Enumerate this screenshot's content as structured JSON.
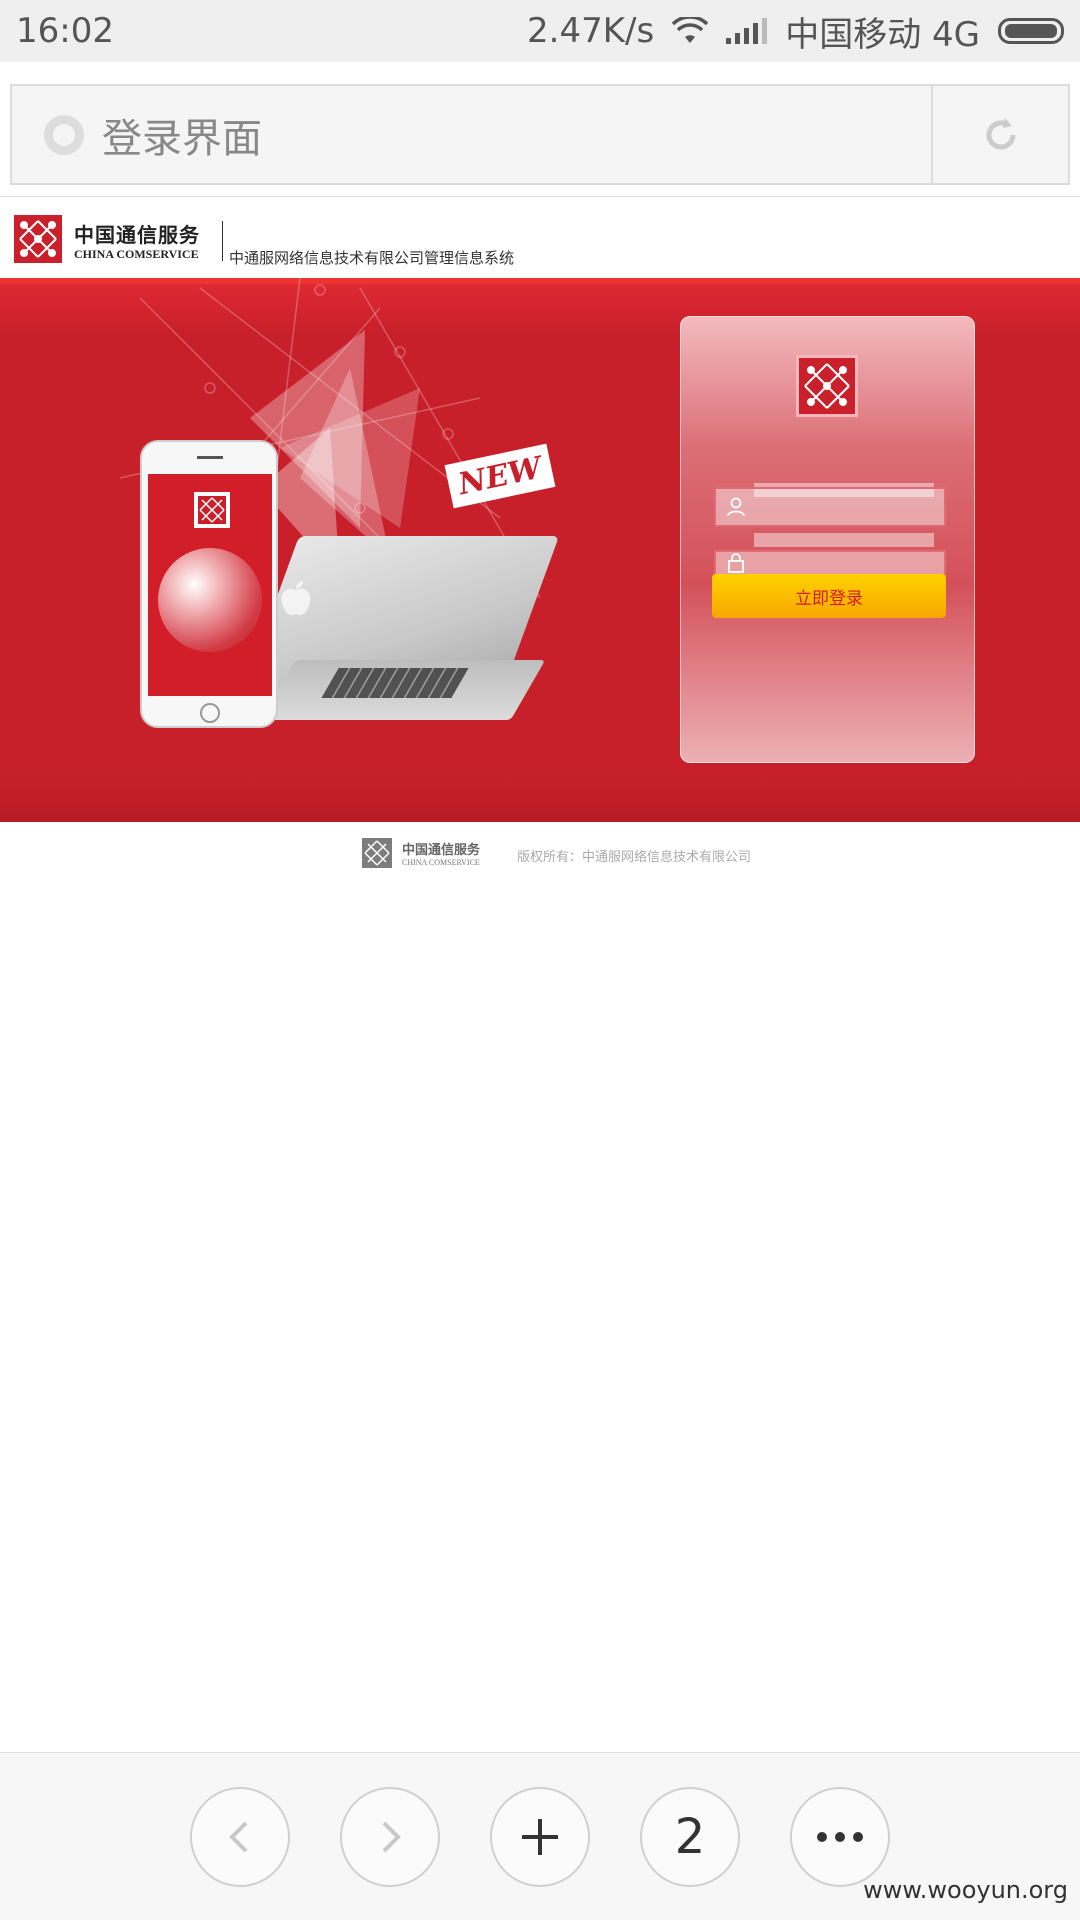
{
  "status_bar": {
    "time": "16:02",
    "speed": "2.47K/s",
    "carrier": "中国移动 4G"
  },
  "browser": {
    "tab_title": "登录界面",
    "icons": {
      "site": "site-loading-icon",
      "reload": "reload-icon"
    }
  },
  "header": {
    "brand_cn": "中国通信服务",
    "brand_en": "CHINA COMSERVICE",
    "system_name": "中通服网络信息技术有限公司管理信息系统"
  },
  "banner": {
    "badge": "NEW"
  },
  "login": {
    "username": {
      "value": "",
      "placeholder": "",
      "icon": "user-icon"
    },
    "password": {
      "value": "",
      "placeholder": "",
      "icon": "lock-icon"
    },
    "submit_label": "立即登录"
  },
  "footer": {
    "brand_cn": "中国通信服务",
    "brand_en": "CHINA COMSERVICE",
    "copyright": "版权所有：中通服网络信息技术有限公司"
  },
  "bottom_nav": {
    "tab_count": "2",
    "icons": [
      "back-icon",
      "forward-icon",
      "new-tab-icon",
      "tabs-icon",
      "more-icon"
    ]
  },
  "watermark": "www.wooyun.org",
  "colors": {
    "brand_red": "#c8202b",
    "button_yellow": "#f6a700",
    "button_text": "#d71a1a"
  }
}
